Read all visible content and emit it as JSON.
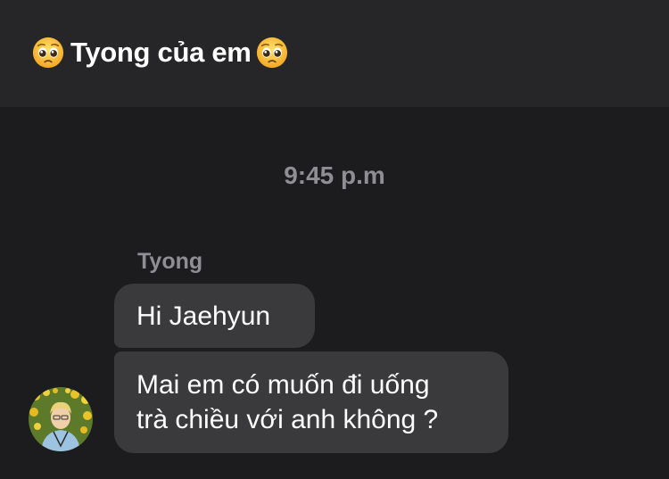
{
  "header": {
    "title": "Tyong của em",
    "left_icon": "pleading-face-emoji",
    "right_icon": "pleading-face-emoji"
  },
  "conversation": {
    "timestamp": "9:45 p.m",
    "sender_name": "Tyong",
    "messages": [
      {
        "text": "Hi Jaehyun"
      },
      {
        "line1": "Mai em có muốn đi uống",
        "line2": "trà chiều với anh không ?"
      }
    ]
  },
  "colors": {
    "background": "#1c1c1e",
    "header_bg": "#262628",
    "bubble_bg": "#3a3a3c",
    "muted_text": "#8e8e93"
  }
}
